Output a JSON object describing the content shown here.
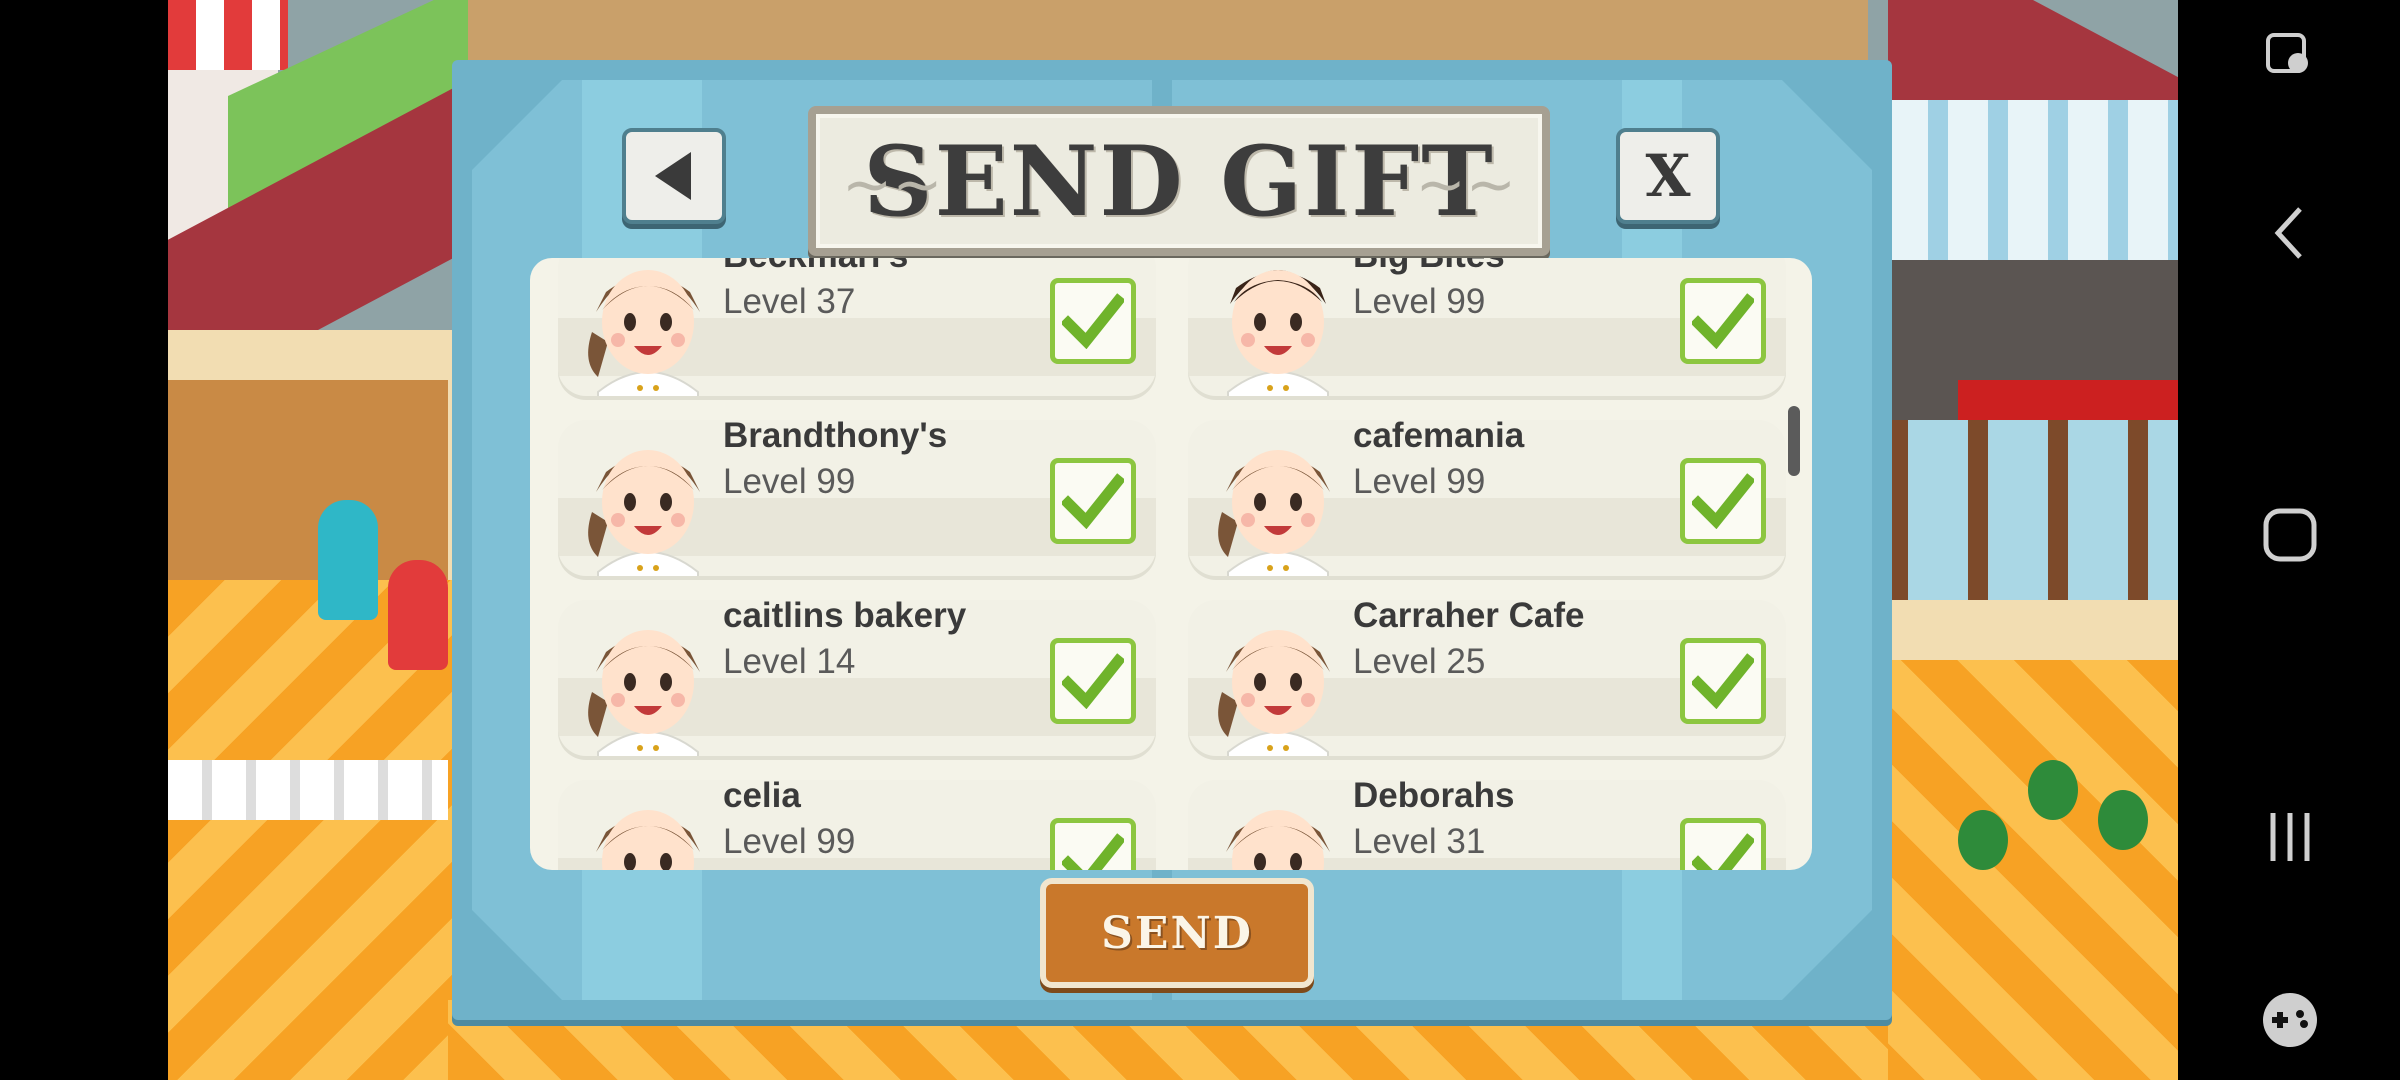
{
  "dialog": {
    "title": "SEND GIFT",
    "close_label": "X",
    "send_label": "SEND"
  },
  "friends": [
    {
      "name": "Beckmari's",
      "level": "Level 37",
      "selected": true,
      "avatar": "female-chef"
    },
    {
      "name": "Big Bites",
      "level": "Level 99",
      "selected": true,
      "avatar": "male-chef"
    },
    {
      "name": "Brandthony's",
      "level": "Level 99",
      "selected": true,
      "avatar": "female-chef"
    },
    {
      "name": "cafemania",
      "level": "Level 99",
      "selected": true,
      "avatar": "female-chef"
    },
    {
      "name": "caitlins bakery",
      "level": "Level 14",
      "selected": true,
      "avatar": "female-chef"
    },
    {
      "name": "Carraher Cafe",
      "level": "Level 25",
      "selected": true,
      "avatar": "female-chef"
    },
    {
      "name": "celia",
      "level": "Level 99",
      "selected": true,
      "avatar": "female-chef"
    },
    {
      "name": "Deborahs",
      "level": "Level 31",
      "selected": true,
      "avatar": "female-chef"
    }
  ],
  "icons": {
    "back": "back-arrow-icon",
    "check": "checkmark-icon",
    "nav": [
      "screen-capture-icon",
      "nav-back-icon",
      "nav-home-icon",
      "nav-recents-icon",
      "game-controller-icon"
    ]
  },
  "colors": {
    "dialog_frame": "#6fb2c9",
    "list_bg": "#f4f3e8",
    "check_green": "#6fb32b",
    "send_button": "#c9782b"
  }
}
